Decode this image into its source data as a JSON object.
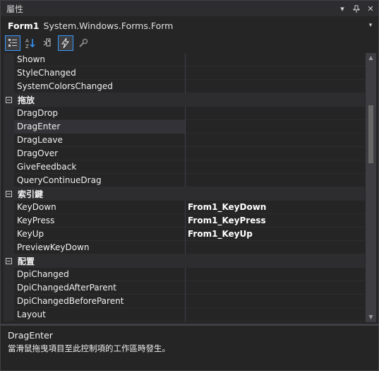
{
  "window": {
    "title": "屬性",
    "dropdown_glyph": "▾",
    "pin_glyph": "⊥",
    "close_glyph": "✕"
  },
  "object_selector": {
    "name": "Form1",
    "type": "System.Windows.Forms.Form",
    "dropdown_glyph": "▾"
  },
  "toolbar": {
    "categorized_icon": "categorized-icon",
    "alphabetical_icon": "alphabetical-icon",
    "properties_icon": "properties-icon",
    "events_icon": "lightning-icon",
    "property_pages_icon": "wrench-icon",
    "active": "events"
  },
  "grid": {
    "rows_top": [
      {
        "name": "Shown",
        "value": ""
      },
      {
        "name": "StyleChanged",
        "value": ""
      },
      {
        "name": "SystemColorsChanged",
        "value": ""
      }
    ],
    "cat_dragdrop": "拖放",
    "rows_dragdrop": [
      {
        "name": "DragDrop",
        "value": ""
      },
      {
        "name": "DragEnter",
        "value": ""
      },
      {
        "name": "DragLeave",
        "value": ""
      },
      {
        "name": "DragOver",
        "value": ""
      },
      {
        "name": "GiveFeedback",
        "value": ""
      },
      {
        "name": "QueryContinueDrag",
        "value": ""
      }
    ],
    "cat_key": "索引鍵",
    "rows_key": [
      {
        "name": "KeyDown",
        "value": "From1_KeyDown"
      },
      {
        "name": "KeyPress",
        "value": "From1_KeyPress"
      },
      {
        "name": "KeyUp",
        "value": "From1_KeyUp"
      },
      {
        "name": "PreviewKeyDown",
        "value": ""
      }
    ],
    "cat_layout": "配置",
    "rows_layout": [
      {
        "name": "DpiChanged",
        "value": ""
      },
      {
        "name": "DpiChangedAfterParent",
        "value": ""
      },
      {
        "name": "DpiChangedBeforeParent",
        "value": ""
      },
      {
        "name": "Layout",
        "value": ""
      }
    ],
    "selected": "DragEnter"
  },
  "scrollbar": {
    "up_glyph": "▲",
    "down_glyph": "▼"
  },
  "description": {
    "title": "DragEnter",
    "text": "當滑鼠拖曳項目至此控制項的工作區時發生。"
  }
}
